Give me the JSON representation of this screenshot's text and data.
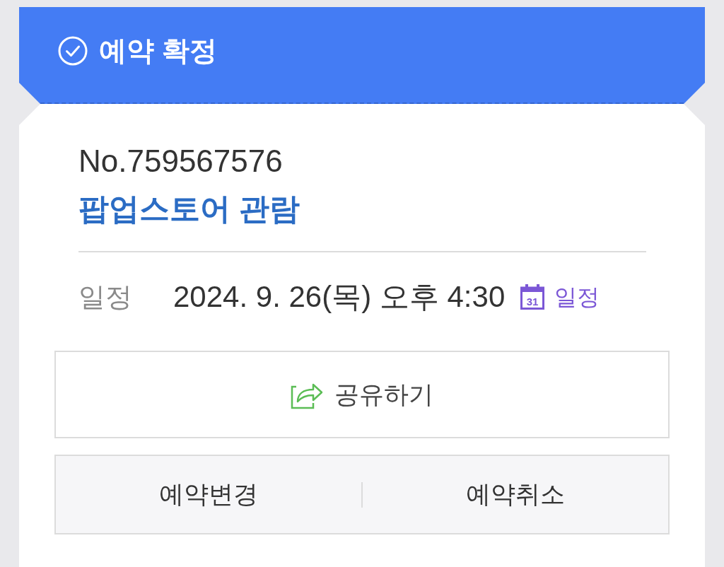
{
  "header": {
    "title": "예약 확정"
  },
  "booking": {
    "number": "No.759567576",
    "title": "팝업스토어 관람"
  },
  "details": [
    {
      "label": "일정",
      "value": "2024. 9. 26(목) 오후 4:30",
      "icon_text": "31",
      "link": "일정"
    }
  ],
  "share_button": {
    "label": "공유하기"
  },
  "actions": [
    {
      "label": "예약변경"
    },
    {
      "label": "예약취소"
    }
  ]
}
